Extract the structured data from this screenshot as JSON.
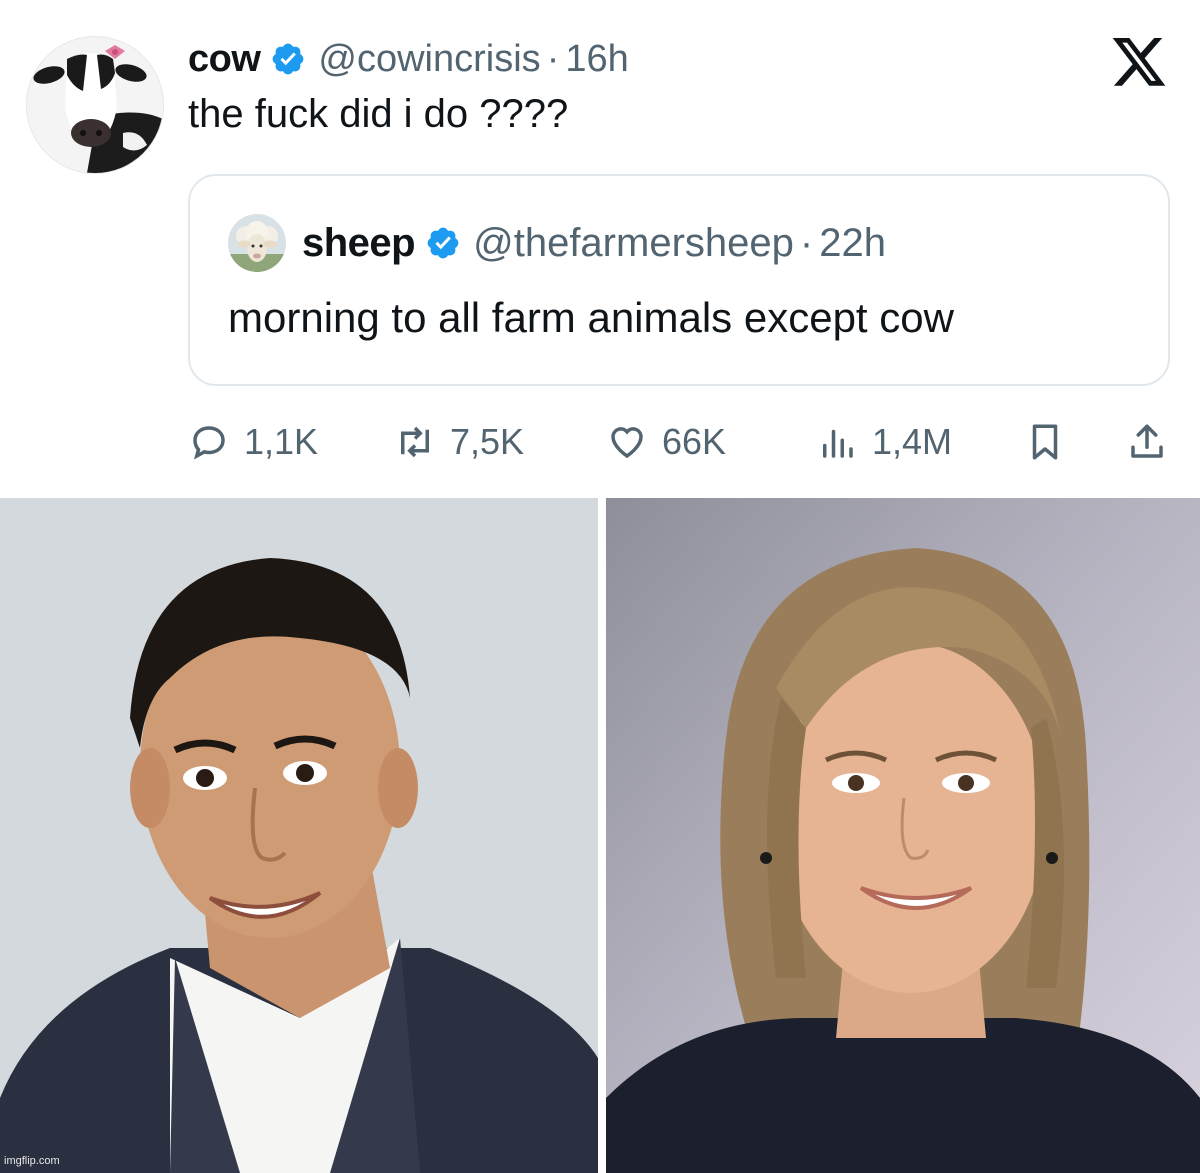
{
  "tweet": {
    "author": {
      "name": "cow",
      "handle": "@cowincrisis",
      "separator": "·",
      "time": "16h"
    },
    "text": "the fuck did i do ????",
    "quoted": {
      "author": {
        "name": "sheep",
        "handle": "@thefarmersheep",
        "separator": "·",
        "time": "22h"
      },
      "text": "morning to all farm animals except cow"
    },
    "actions": {
      "replies": "1,1K",
      "retweets": "7,5K",
      "likes": "66K",
      "views": "1,4M"
    },
    "accent_color": "#1d9bf0",
    "muted_color": "#536471"
  },
  "icons": [
    "verified-badge-icon",
    "x-logo-icon",
    "reply-icon",
    "retweet-icon",
    "like-icon",
    "views-icon",
    "bookmark-icon",
    "share-icon"
  ],
  "watermark": "imgflip.com"
}
